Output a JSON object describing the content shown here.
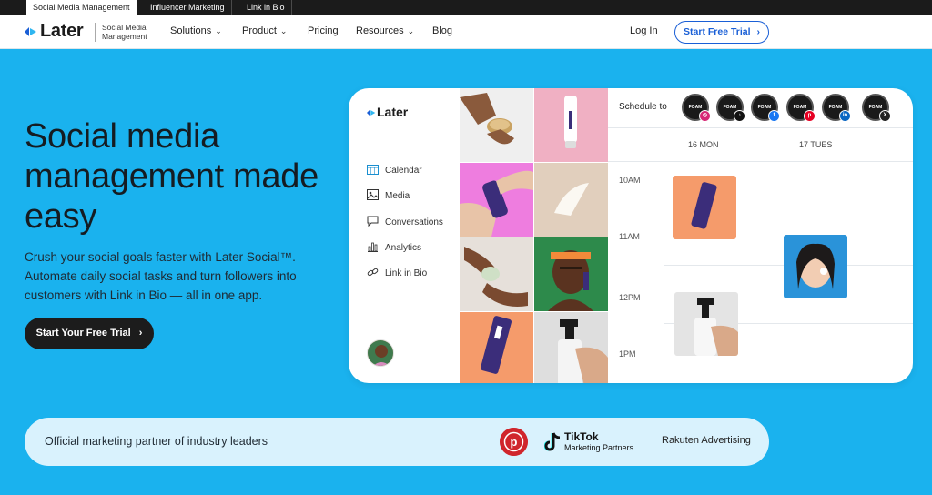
{
  "topbar": {
    "tabs": [
      {
        "label": "Social Media Management",
        "active": true
      },
      {
        "label": "Influencer Marketing",
        "active": false
      },
      {
        "label": "Link in Bio",
        "active": false
      }
    ]
  },
  "nav": {
    "brand": "Later",
    "brand_sub": "Social Media Management",
    "items": [
      {
        "label": "Solutions",
        "dropdown": true
      },
      {
        "label": "Product",
        "dropdown": true
      },
      {
        "label": "Pricing",
        "dropdown": false
      },
      {
        "label": "Resources",
        "dropdown": true
      },
      {
        "label": "Blog",
        "dropdown": false
      }
    ],
    "login": "Log In",
    "trial": "Start Free Trial"
  },
  "hero": {
    "title": "Social media management made easy",
    "subtitle": "Crush your social goals faster with Later Social™. Automate daily social tasks and turn followers into customers with Link in Bio — all in one app.",
    "cta": "Start Your Free Trial"
  },
  "app": {
    "brand": "Later",
    "menu": [
      {
        "label": "Calendar",
        "icon": "calendar-icon"
      },
      {
        "label": "Media",
        "icon": "image-icon"
      },
      {
        "label": "Conversations",
        "icon": "chat-icon"
      },
      {
        "label": "Analytics",
        "icon": "bar-chart-icon"
      },
      {
        "label": "Link in Bio",
        "icon": "link-icon"
      }
    ],
    "schedule": {
      "label": "Schedule to",
      "account_text": "FOAM",
      "accounts": [
        {
          "network": "instagram",
          "color": "#d62976",
          "glyph": "◎"
        },
        {
          "network": "tiktok",
          "color": "#111111",
          "glyph": "♪"
        },
        {
          "network": "facebook",
          "color": "#1877f2",
          "glyph": "f"
        },
        {
          "network": "pinterest",
          "color": "#e60023",
          "glyph": "p"
        },
        {
          "network": "linkedin",
          "color": "#0a66c2",
          "glyph": "in"
        },
        {
          "network": "x",
          "color": "#222222",
          "glyph": "X"
        }
      ],
      "days": [
        "16 MON",
        "17 TUES"
      ],
      "times": [
        "10AM",
        "11AM",
        "12PM",
        "1PM"
      ]
    }
  },
  "partners": {
    "text": "Official marketing partner of industry leaders",
    "tiktok_name": "TikTok",
    "tiktok_sub": "Marketing Partners",
    "rakuten": "Rakuten Advertising"
  },
  "colors": {
    "hero_bg": "#1ab2ee",
    "accent_blue": "#1a5fd6",
    "dark_button": "#1c1c1c",
    "partner_bar": "#d9f2fd"
  }
}
